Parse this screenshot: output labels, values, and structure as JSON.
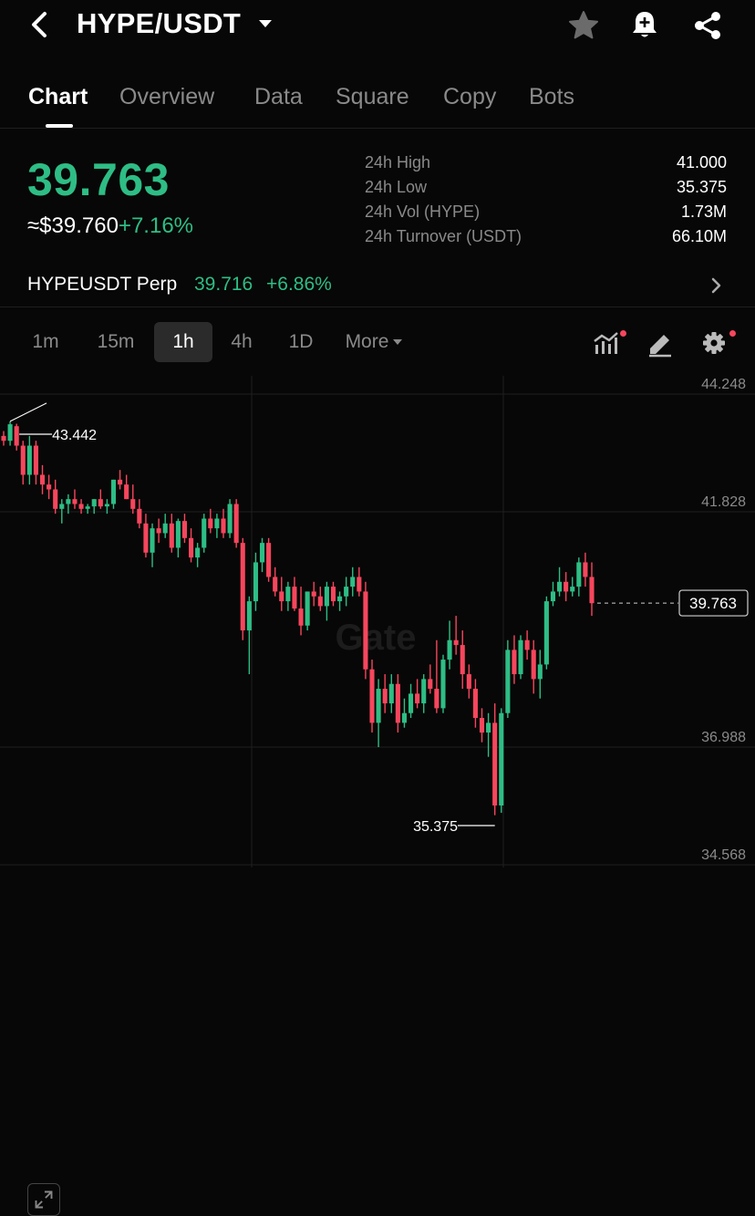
{
  "header": {
    "pair": "HYPE/USDT"
  },
  "icons": {
    "back": "back-arrow-icon",
    "dropdown": "caret-down-icon",
    "favorite": "star-icon",
    "alert": "bell-plus-icon",
    "share": "share-icon",
    "indicators": "indicator-chart-icon",
    "draw": "pencil-icon",
    "settings": "gear-icon",
    "expand": "expand-icon",
    "perp": "chevron-right-icon"
  },
  "tabs": [
    {
      "label": "Chart",
      "active": true
    },
    {
      "label": "Overview",
      "active": false
    },
    {
      "label": "Data",
      "active": false
    },
    {
      "label": "Square",
      "active": false
    },
    {
      "label": "Copy",
      "active": false
    },
    {
      "label": "Bots",
      "active": false
    }
  ],
  "ticker": {
    "last_price": "39.763",
    "fiat_price": "≈$39.760",
    "change_pct": "+7.16%"
  },
  "stats": [
    {
      "label": "24h High",
      "value": "41.000"
    },
    {
      "label": "24h Low",
      "value": "35.375"
    },
    {
      "label": "24h Vol (HYPE)",
      "value": "1.73M"
    },
    {
      "label": "24h Turnover (USDT)",
      "value": "66.10M"
    }
  ],
  "perp": {
    "name": "HYPEUSDT Perp",
    "price": "39.716",
    "change_pct": "+6.86%"
  },
  "intervals": [
    {
      "label": "1m",
      "active": false
    },
    {
      "label": "15m",
      "active": false
    },
    {
      "label": "1h",
      "active": true
    },
    {
      "label": "4h",
      "active": false
    },
    {
      "label": "1D",
      "active": false
    },
    {
      "label": "More",
      "active": false
    }
  ],
  "colors": {
    "up": "#2ebd85",
    "down": "#f6465d",
    "background": "#070707",
    "grid": "#1f1f1f",
    "muted": "#8a8a8a"
  },
  "chart_data": {
    "type": "candlestick",
    "watermark": "Gate",
    "y_ticks": [
      "44.248",
      "41.828",
      "36.988",
      "34.568"
    ],
    "y_tick_values": [
      44.248,
      41.828,
      36.988,
      34.568
    ],
    "ylim": [
      34.568,
      44.248
    ],
    "high_marker": "43.442",
    "low_marker": "35.375",
    "current_price_label": "39.763",
    "current_price": 39.763,
    "candles": [
      [
        43.2,
        43.3,
        43.0,
        43.1
      ],
      [
        43.1,
        43.5,
        43.0,
        43.44
      ],
      [
        43.4,
        43.45,
        42.9,
        43.0
      ],
      [
        43.0,
        43.1,
        42.2,
        42.4
      ],
      [
        42.4,
        43.2,
        42.2,
        43.0
      ],
      [
        43.0,
        43.1,
        42.2,
        42.4
      ],
      [
        42.4,
        42.6,
        42.0,
        42.2
      ],
      [
        42.2,
        42.4,
        41.9,
        42.1
      ],
      [
        42.1,
        42.3,
        41.6,
        41.7
      ],
      [
        41.7,
        41.9,
        41.4,
        41.8
      ],
      [
        41.8,
        42.0,
        41.6,
        41.9
      ],
      [
        41.9,
        42.1,
        41.7,
        41.8
      ],
      [
        41.8,
        41.9,
        41.6,
        41.7
      ],
      [
        41.7,
        41.8,
        41.6,
        41.75
      ],
      [
        41.75,
        41.9,
        41.6,
        41.9
      ],
      [
        41.9,
        42.1,
        41.7,
        41.75
      ],
      [
        41.75,
        41.9,
        41.6,
        41.8
      ],
      [
        41.8,
        42.3,
        41.7,
        42.3
      ],
      [
        42.3,
        42.5,
        42.1,
        42.2
      ],
      [
        42.2,
        42.4,
        41.9,
        41.9
      ],
      [
        41.9,
        42.2,
        41.6,
        41.7
      ],
      [
        41.7,
        41.9,
        41.3,
        41.4
      ],
      [
        41.4,
        41.6,
        40.7,
        40.8
      ],
      [
        40.8,
        41.4,
        40.5,
        41.3
      ],
      [
        41.3,
        41.5,
        41.0,
        41.2
      ],
      [
        41.2,
        41.6,
        41.1,
        41.4
      ],
      [
        41.4,
        41.6,
        40.8,
        40.9
      ],
      [
        40.9,
        41.5,
        40.7,
        41.45
      ],
      [
        41.45,
        41.6,
        41.0,
        41.1
      ],
      [
        41.1,
        41.3,
        40.6,
        40.7
      ],
      [
        40.7,
        41.0,
        40.5,
        40.9
      ],
      [
        40.9,
        41.6,
        40.8,
        41.5
      ],
      [
        41.5,
        41.7,
        41.2,
        41.3
      ],
      [
        41.3,
        41.6,
        41.1,
        41.5
      ],
      [
        41.5,
        41.7,
        41.1,
        41.2
      ],
      [
        41.2,
        41.9,
        41.1,
        41.8
      ],
      [
        41.8,
        41.9,
        40.9,
        41.0
      ],
      [
        41.0,
        41.1,
        39.0,
        39.2
      ],
      [
        39.2,
        39.9,
        38.3,
        39.8
      ],
      [
        39.8,
        40.8,
        39.6,
        40.6
      ],
      [
        40.6,
        41.1,
        40.4,
        41.0
      ],
      [
        41.0,
        41.1,
        40.2,
        40.3
      ],
      [
        40.3,
        40.5,
        39.9,
        40.0
      ],
      [
        40.0,
        40.3,
        39.6,
        39.8
      ],
      [
        39.8,
        40.2,
        39.6,
        40.1
      ],
      [
        40.1,
        40.3,
        39.6,
        39.65
      ],
      [
        39.65,
        40.1,
        39.1,
        39.3
      ],
      [
        39.3,
        40.0,
        39.2,
        40.0
      ],
      [
        40.0,
        40.2,
        39.7,
        39.9
      ],
      [
        39.9,
        40.1,
        39.6,
        39.7
      ],
      [
        39.7,
        40.2,
        39.4,
        40.1
      ],
      [
        40.1,
        40.2,
        39.7,
        39.8
      ],
      [
        39.8,
        40.0,
        39.6,
        39.9
      ],
      [
        39.9,
        40.3,
        39.7,
        40.1
      ],
      [
        40.1,
        40.5,
        39.9,
        40.3
      ],
      [
        40.3,
        40.5,
        39.9,
        40.0
      ],
      [
        40.0,
        40.2,
        38.2,
        38.4
      ],
      [
        38.4,
        38.6,
        37.1,
        37.3
      ],
      [
        37.3,
        38.2,
        36.8,
        38.0
      ],
      [
        38.0,
        38.3,
        37.5,
        37.7
      ],
      [
        37.7,
        38.3,
        37.5,
        38.1
      ],
      [
        38.1,
        38.3,
        37.1,
        37.3
      ],
      [
        37.3,
        37.8,
        37.2,
        37.5
      ],
      [
        37.5,
        38.1,
        37.4,
        37.9
      ],
      [
        37.9,
        38.2,
        37.6,
        37.7
      ],
      [
        37.7,
        38.3,
        37.5,
        38.2
      ],
      [
        38.2,
        38.5,
        37.9,
        38.0
      ],
      [
        38.0,
        39.0,
        37.5,
        37.6
      ],
      [
        37.6,
        38.7,
        37.5,
        38.6
      ],
      [
        38.6,
        39.4,
        38.4,
        39.0
      ],
      [
        39.0,
        39.5,
        38.7,
        38.9
      ],
      [
        38.9,
        39.2,
        38.0,
        38.3
      ],
      [
        38.3,
        38.5,
        37.8,
        38.0
      ],
      [
        38.0,
        38.2,
        37.2,
        37.4
      ],
      [
        37.4,
        37.6,
        36.9,
        37.1
      ],
      [
        37.1,
        37.5,
        36.6,
        37.3
      ],
      [
        37.3,
        37.7,
        35.4,
        35.6
      ],
      [
        35.6,
        37.6,
        35.45,
        37.5
      ],
      [
        37.5,
        39.0,
        37.4,
        38.8
      ],
      [
        38.8,
        39.1,
        38.1,
        38.3
      ],
      [
        38.3,
        39.1,
        38.2,
        39.0
      ],
      [
        39.0,
        39.2,
        38.6,
        38.8
      ],
      [
        38.8,
        39.0,
        37.9,
        38.2
      ],
      [
        38.2,
        38.8,
        37.8,
        38.5
      ],
      [
        38.5,
        39.9,
        38.4,
        39.8
      ],
      [
        39.8,
        40.2,
        39.7,
        40.0
      ],
      [
        40.0,
        40.5,
        39.9,
        40.2
      ],
      [
        40.2,
        40.4,
        39.8,
        40.0
      ],
      [
        40.0,
        40.3,
        39.9,
        40.1
      ],
      [
        40.1,
        40.7,
        39.9,
        40.6
      ],
      [
        40.6,
        40.8,
        40.1,
        40.3
      ],
      [
        40.3,
        40.6,
        39.5,
        39.76
      ]
    ]
  }
}
